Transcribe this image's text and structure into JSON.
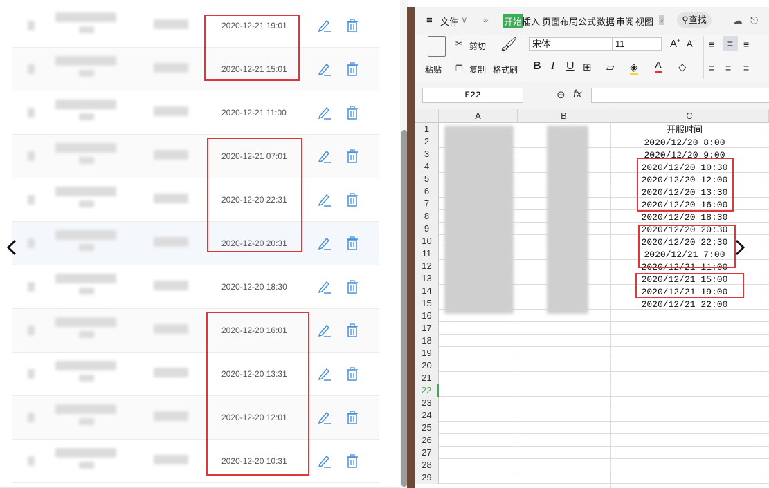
{
  "web_table": {
    "rows": [
      {
        "time": "2020-12-21 19:01"
      },
      {
        "time": "2020-12-21 15:01"
      },
      {
        "time": "2020-12-21 11:00"
      },
      {
        "time": "2020-12-21 07:01"
      },
      {
        "time": "2020-12-20 22:31"
      },
      {
        "time": "2020-12-20 20:31"
      },
      {
        "time": "2020-12-20 18:30"
      },
      {
        "time": "2020-12-20 16:01"
      },
      {
        "time": "2020-12-20 13:31"
      },
      {
        "time": "2020-12-20 12:01"
      },
      {
        "time": "2020-12-20 10:31"
      }
    ],
    "edit_icon": "pencil-edit-icon",
    "delete_icon": "trash-icon"
  },
  "colors": {
    "annotation_red": "#e0353b",
    "wps_green": "#3daa55",
    "icon_blue": "#4a90d9"
  },
  "spreadsheet": {
    "menu": {
      "file": "文件",
      "tabs": [
        "开始",
        "插入",
        "页面布局",
        "公式",
        "数据",
        "审阅",
        "视图"
      ],
      "active_tab": "开始",
      "search": "查找"
    },
    "ribbon": {
      "paste": "粘贴",
      "cut": "剪切",
      "copy": "复制",
      "format_painter": "格式刷",
      "font_name": "宋体",
      "font_size": "11",
      "bold": "B",
      "italic": "I",
      "underline": "U"
    },
    "name_box": "F22",
    "fx_label": "fx",
    "columns": [
      "A",
      "B",
      "C"
    ],
    "header_cell": "开服时间",
    "column_c": [
      "2020/12/20 8:00",
      "2020/12/20 9:00",
      "2020/12/20 10:30",
      "2020/12/20 12:00",
      "2020/12/20 13:30",
      "2020/12/20 16:00",
      "2020/12/20 18:30",
      "2020/12/20 20:30",
      "2020/12/20 22:30",
      "2020/12/21 7:00",
      "2020/12/21 11:00",
      "2020/12/21 15:00",
      "2020/12/21 19:00",
      "2020/12/21 22:00"
    ],
    "row_numbers": [
      "1",
      "2",
      "3",
      "4",
      "5",
      "6",
      "7",
      "8",
      "9",
      "10",
      "11",
      "12",
      "13",
      "14",
      "15",
      "16",
      "17",
      "18",
      "19",
      "20",
      "21",
      "22",
      "23",
      "24",
      "25",
      "26",
      "27",
      "28",
      "29"
    ],
    "selected_row": "22"
  }
}
